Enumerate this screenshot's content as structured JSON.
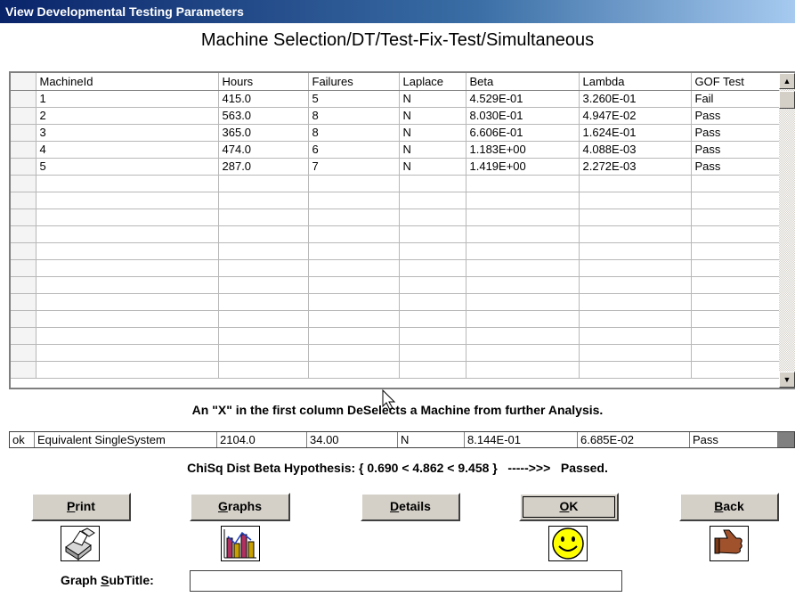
{
  "window": {
    "title": "View Developmental Testing Parameters"
  },
  "heading": "Machine Selection/DT/Test-Fix-Test/Simultaneous",
  "grid": {
    "columns": [
      "",
      "MachineId",
      "Hours",
      "Failures",
      "Laplace",
      "Beta",
      "Lambda",
      "GOF Test"
    ],
    "rows": [
      [
        "",
        "1",
        "415.0",
        "5",
        "N",
        "4.529E-01",
        "3.260E-01",
        "Fail"
      ],
      [
        "",
        "2",
        "563.0",
        "8",
        "N",
        "8.030E-01",
        "4.947E-02",
        "Pass"
      ],
      [
        "",
        "3",
        "365.0",
        "8",
        "N",
        "6.606E-01",
        "1.624E-01",
        "Pass"
      ],
      [
        "",
        "4",
        "474.0",
        "6",
        "N",
        "1.183E+00",
        "4.088E-03",
        "Pass"
      ],
      [
        "",
        "5",
        "287.0",
        "7",
        "N",
        "1.419E+00",
        "2.272E-03",
        "Pass"
      ]
    ],
    "empty_rows": 12
  },
  "note": "An \"X\" in the first column DeSelects a Machine from further Analysis.",
  "summary": {
    "select": "ok",
    "name": "Equivalent SingleSystem",
    "hours": "2104.0",
    "failures": "34.00",
    "laplace": "N",
    "beta": "8.144E-01",
    "lambda": "6.685E-02",
    "gof": "Pass"
  },
  "chisq_line": "ChiSq Dist Beta Hypothesis: { 0.690 < 4.862 < 9.458 }   ----->>>   Passed.",
  "buttons": {
    "print": {
      "mnemonic": "P",
      "rest": "rint",
      "icon": "printer-icon"
    },
    "graphs": {
      "mnemonic": "G",
      "rest": "raphs",
      "icon": "bar-chart-icon"
    },
    "details": {
      "mnemonic": "D",
      "rest": "etails"
    },
    "ok": {
      "mnemonic": "O",
      "rest": "K",
      "icon": "smiley-icon"
    },
    "back": {
      "mnemonic": "B",
      "rest": "ack",
      "icon": "thumbs-back-icon"
    }
  },
  "subtitle": {
    "pre": "Graph ",
    "mnemonic": "S",
    "post": "ubTitle:",
    "value": ""
  },
  "colors": {
    "titlebar": "#0a246a",
    "face": "#d4d0c8",
    "smiley": "#ffff00",
    "chart_bar": "#b03060"
  }
}
